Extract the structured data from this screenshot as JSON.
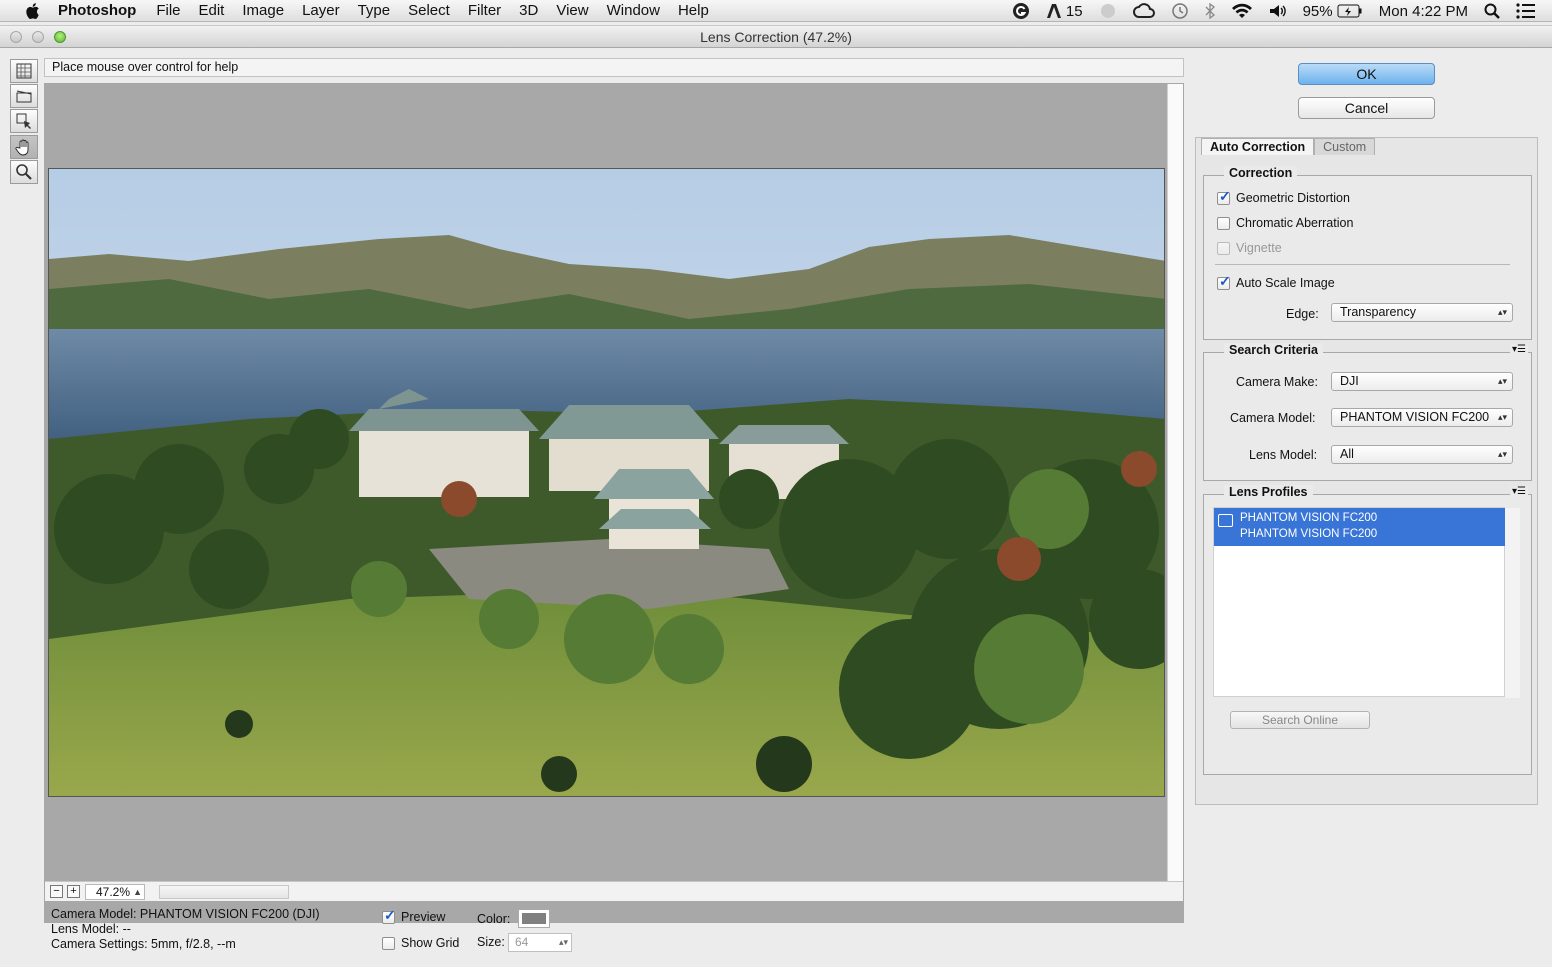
{
  "menubar": {
    "app_name": "Photoshop",
    "items": [
      "File",
      "Edit",
      "Image",
      "Layer",
      "Type",
      "Select",
      "Filter",
      "3D",
      "View",
      "Window",
      "Help"
    ],
    "adobe_badge": "15",
    "battery": "95%",
    "clock": "Mon 4:22 PM"
  },
  "window": {
    "title": "Lens Correction (47.2%)"
  },
  "help_text": "Place mouse over control for help",
  "zoom": {
    "value": "47.2%"
  },
  "info": {
    "camera_model": "Camera Model: PHANTOM VISION FC200 (DJI)",
    "lens_model": "Lens Model: --",
    "camera_settings": "Camera Settings: 5mm, f/2.8, --m"
  },
  "options": {
    "preview_label": "Preview",
    "preview_checked": true,
    "show_grid_label": "Show Grid",
    "show_grid_checked": false,
    "color_label": "Color:",
    "grid_color": "#808080",
    "size_label": "Size:",
    "size_value": "64"
  },
  "buttons": {
    "ok": "OK",
    "cancel": "Cancel"
  },
  "tabs": [
    "Auto Correction",
    "Custom"
  ],
  "correction": {
    "title": "Correction",
    "geometric_distortion": {
      "label": "Geometric Distortion",
      "checked": true
    },
    "chromatic_aberration": {
      "label": "Chromatic Aberration",
      "checked": false
    },
    "vignette": {
      "label": "Vignette",
      "checked": false
    },
    "auto_scale": {
      "label": "Auto Scale Image",
      "checked": true
    },
    "edge_label": "Edge:",
    "edge_value": "Transparency"
  },
  "search_criteria": {
    "title": "Search Criteria",
    "camera_make_label": "Camera Make:",
    "camera_make_value": "DJI",
    "camera_model_label": "Camera Model:",
    "camera_model_value": "PHANTOM VISION FC200",
    "lens_model_label": "Lens Model:",
    "lens_model_value": "All"
  },
  "lens_profiles": {
    "title": "Lens Profiles",
    "selected_line1": "PHANTOM VISION FC200",
    "selected_line2": "PHANTOM VISION FC200",
    "search_online": "Search Online"
  },
  "colors": {
    "accent": "#3875d7",
    "ok_button": "#6fb2ec"
  },
  "icons": [
    "apple-icon",
    "wifi-icon",
    "volume-icon",
    "bluetooth-icon",
    "spotlight-icon",
    "notification-icon",
    "remove-distortion-tool-icon",
    "straighten-tool-icon",
    "move-grid-tool-icon",
    "hand-tool-icon",
    "zoom-tool-icon"
  ]
}
